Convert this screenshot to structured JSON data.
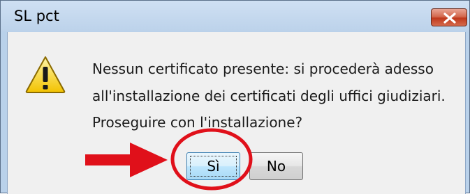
{
  "window": {
    "title": "SL pct",
    "close_icon": "close-icon"
  },
  "message": {
    "line1": "Nessun certificato presente: si procederà adesso",
    "line2": "all'installazione dei certificati degli uffici giudiziari.",
    "line3": "Proseguire con l'installazione?",
    "icon": "warning-icon"
  },
  "buttons": {
    "yes_label": "Sì",
    "no_label": "No"
  },
  "annotation": {
    "arrow_color": "#e0101a",
    "circle_color": "#e0101a"
  }
}
